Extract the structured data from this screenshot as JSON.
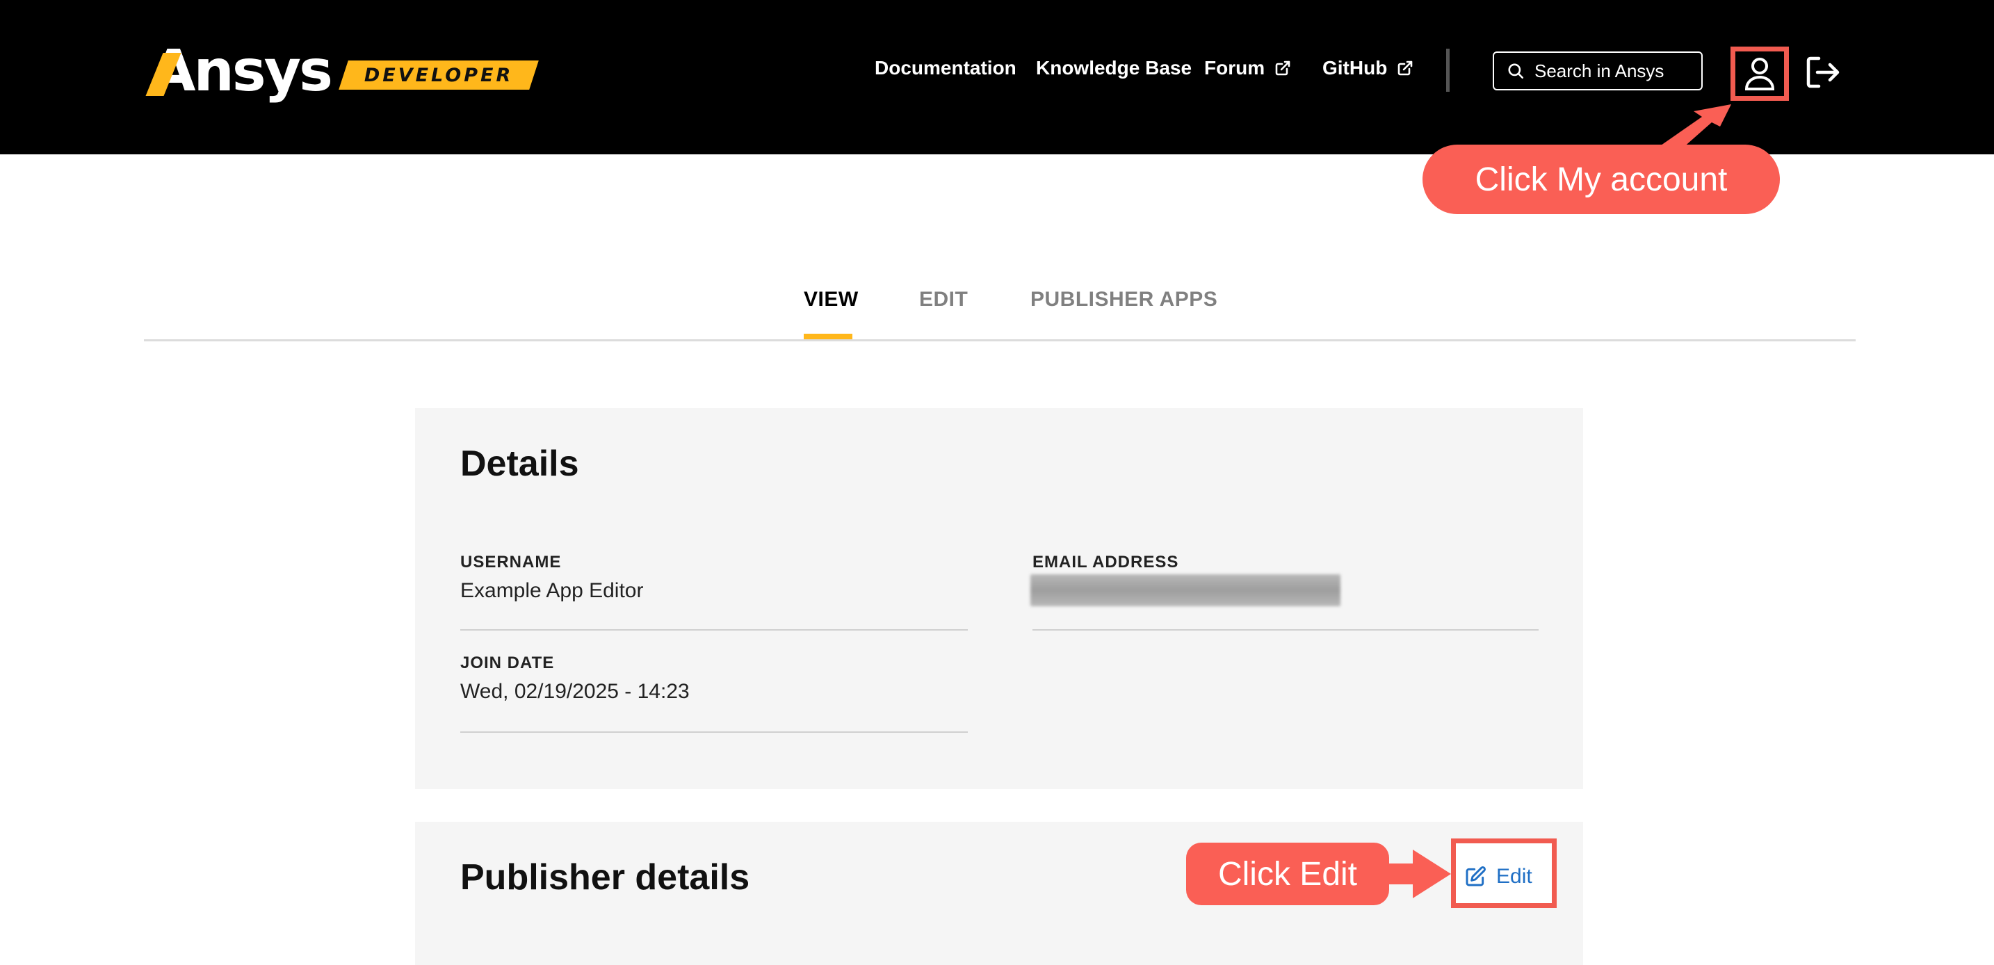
{
  "brand": {
    "name": "Ansys",
    "badge": "DEVELOPER",
    "accent": "#ffb71b"
  },
  "nav": {
    "documentation": "Documentation",
    "knowledge_base": "Knowledge Base",
    "forum": "Forum",
    "github": "GitHub"
  },
  "search": {
    "placeholder": "Search in Ansys"
  },
  "icons": {
    "external": "external-link-icon",
    "search": "search-icon",
    "account": "user-icon",
    "logout": "logout-icon",
    "edit": "edit-icon"
  },
  "annotations": {
    "account_callout": "Click My account",
    "edit_callout": "Click Edit",
    "color": "#fa5f55"
  },
  "tabs": [
    {
      "label": "VIEW",
      "active": true
    },
    {
      "label": "EDIT",
      "active": false
    },
    {
      "label": "PUBLISHER APPS",
      "active": false
    }
  ],
  "details": {
    "title": "Details",
    "username_label": "USERNAME",
    "username_value": "Example App Editor",
    "email_label": "EMAIL ADDRESS",
    "join_date_label": "JOIN DATE",
    "join_date_value": "Wed, 02/19/2025 - 14:23"
  },
  "publisher": {
    "title": "Publisher details",
    "edit_label": "Edit",
    "link_color": "#1f6fc5"
  }
}
